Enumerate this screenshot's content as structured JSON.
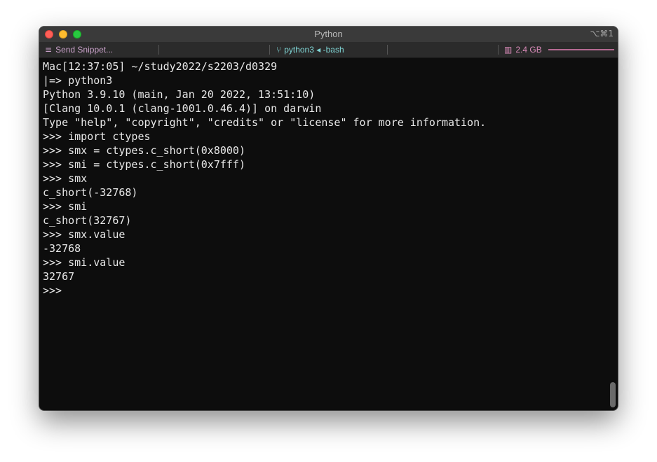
{
  "window": {
    "title": "Python",
    "shortcut": "⌥⌘1"
  },
  "tabbar": {
    "snippet_icon": "hamburger-icon",
    "snippet_label": "Send Snippet...",
    "session_icon": "branch-icon",
    "session_label": "python3 ◂ -bash",
    "memory_icon": "memory-icon",
    "memory_label": "2.4 GB"
  },
  "terminal": {
    "lines": [
      "Mac[12:37:05] ~/study2022/s2203/d0329",
      "|=> python3",
      "Python 3.9.10 (main, Jan 20 2022, 13:51:10)",
      "[Clang 10.0.1 (clang-1001.0.46.4)] on darwin",
      "Type \"help\", \"copyright\", \"credits\" or \"license\" for more information.",
      ">>> import ctypes",
      ">>> smx = ctypes.c_short(0x8000)",
      ">>> smi = ctypes.c_short(0x7fff)",
      ">>> smx",
      "c_short(-32768)",
      ">>> smi",
      "c_short(32767)",
      ">>> smx.value",
      "-32768",
      ">>> smi.value",
      "32767",
      ">>> "
    ]
  }
}
